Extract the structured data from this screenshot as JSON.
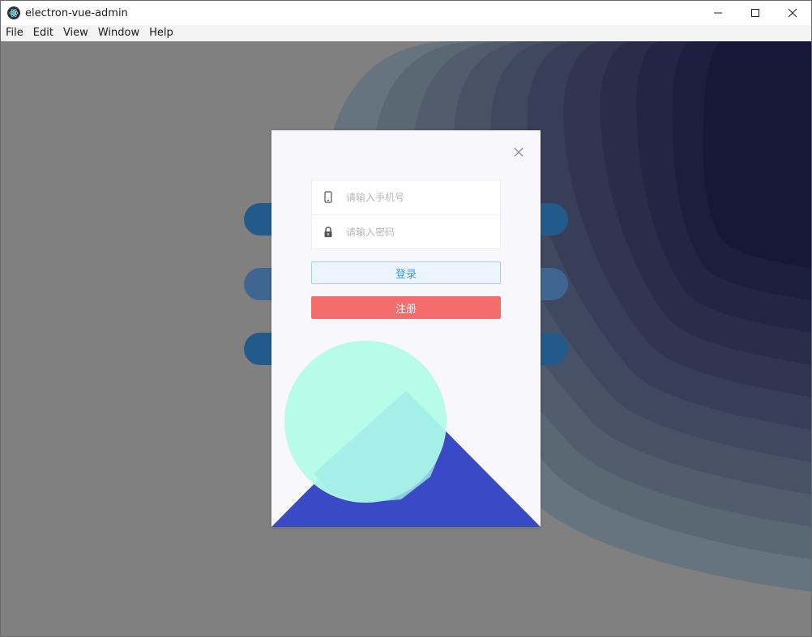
{
  "window": {
    "title": "electron-vue-admin"
  },
  "menubar": {
    "items": [
      "File",
      "Edit",
      "View",
      "Window",
      "Help"
    ]
  },
  "login_dialog": {
    "phone_placeholder": "请输入手机号",
    "password_placeholder": "请输入密码",
    "login_label": "登录",
    "register_label": "注册"
  },
  "colors": {
    "overlay_gray": "#808080",
    "dialog_bg": "#f8f8fc",
    "login_btn_bg": "#ecf5ff",
    "login_btn_text": "#409eff",
    "register_btn_bg": "#f56c6c",
    "mountain": "#3a4ac6",
    "circle": "#b3fbe8",
    "background_pill": "#235a8c"
  },
  "icons": {
    "app": "electron-icon",
    "minimize": "minimize-icon",
    "maximize": "maximize-icon",
    "close": "close-icon",
    "phone": "mobile-phone-icon",
    "lock": "lock-icon",
    "dialog_close": "close-icon"
  }
}
